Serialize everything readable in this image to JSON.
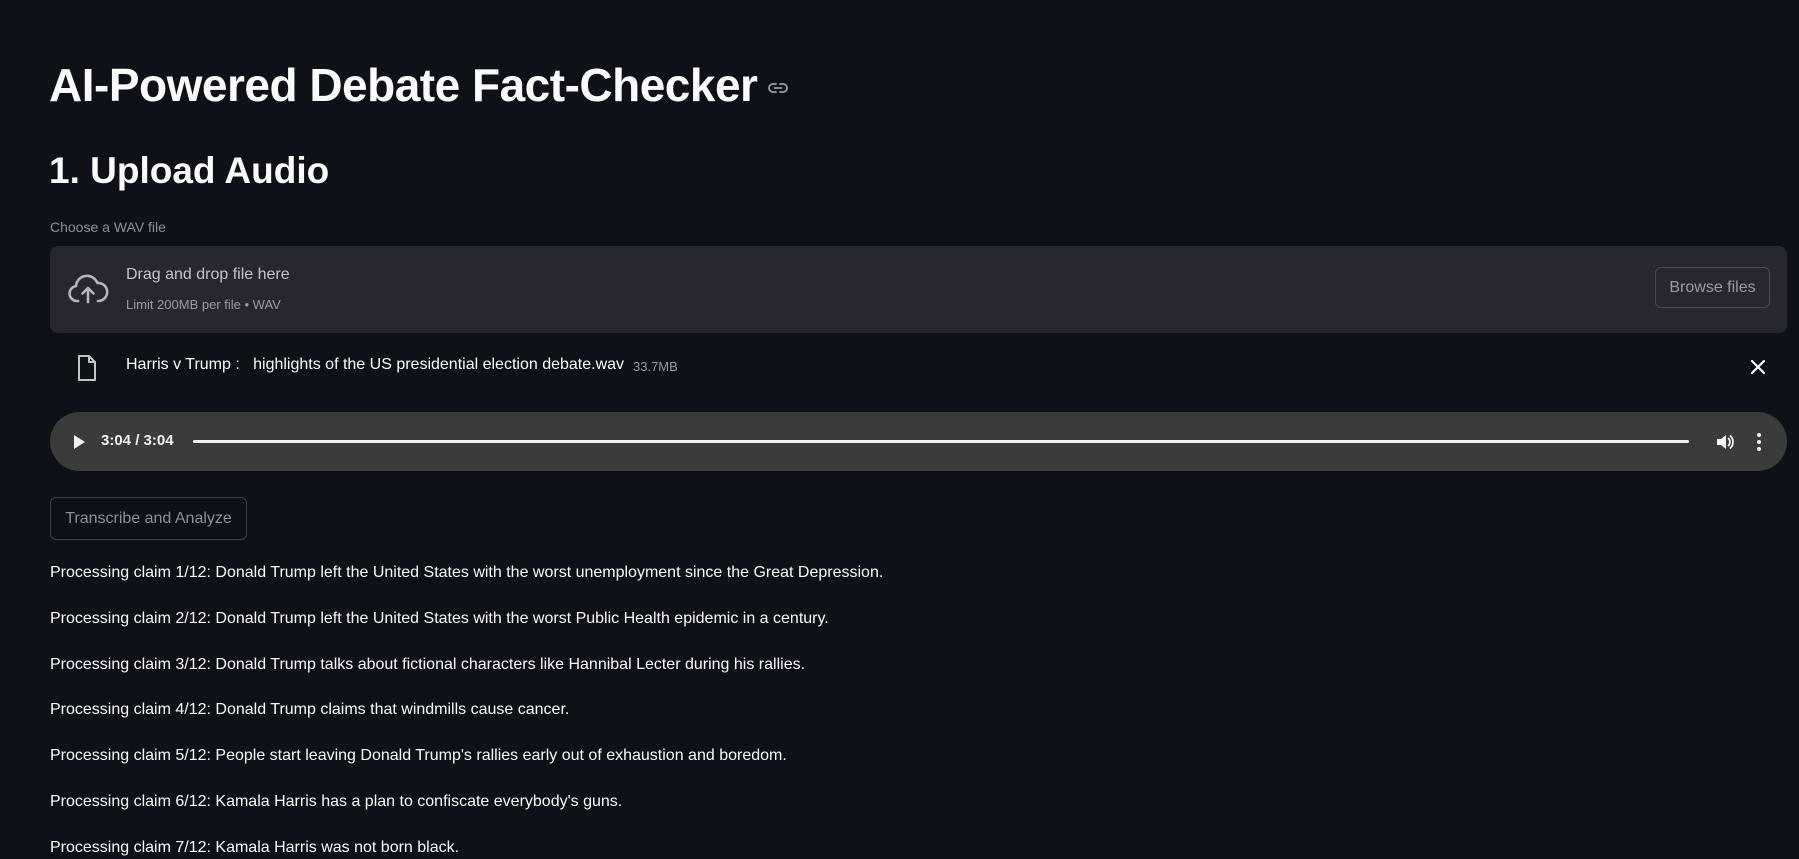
{
  "header": {
    "title": "AI-Powered Debate Fact-Checker",
    "title_anchor_icon": "link-icon"
  },
  "upload_section": {
    "heading": "1. Upload Audio",
    "uploader_label": "Choose a WAV file",
    "dropzone": {
      "icon": "cloud-upload-icon",
      "instruction": "Drag and drop file here",
      "limit": "Limit 200MB per file • WAV",
      "browse_label": "Browse files"
    },
    "uploaded_file": {
      "icon": "file-icon",
      "name": "Harris v Trump :   highlights of the US presidential election debate.wav",
      "size": "33.7MB",
      "remove_icon": "close-icon"
    }
  },
  "audio_player": {
    "play_icon": "play-icon",
    "time": "3:04 / 3:04",
    "progress": 1.0,
    "volume_icon": "volume-icon",
    "menu_icon": "more-vertical-icon"
  },
  "actions": {
    "transcribe_label": "Transcribe and Analyze"
  },
  "claims": [
    "Processing claim 1/12: Donald Trump left the United States with the worst unemployment since the Great Depression.",
    "Processing claim 2/12: Donald Trump left the United States with the worst Public Health epidemic in a century.",
    "Processing claim 3/12: Donald Trump talks about fictional characters like Hannibal Lecter during his rallies.",
    "Processing claim 4/12: Donald Trump claims that windmills cause cancer.",
    "Processing claim 5/12: People start leaving Donald Trump's rallies early out of exhaustion and boredom.",
    "Processing claim 6/12: Kamala Harris has a plan to confiscate everybody's guns.",
    "Processing claim 7/12: Kamala Harris was not born black."
  ],
  "colors": {
    "background": "#0e1117",
    "surface": "#262730",
    "player": "#3b3b3b",
    "text": "#fafafa",
    "muted": "#8c8f96"
  }
}
